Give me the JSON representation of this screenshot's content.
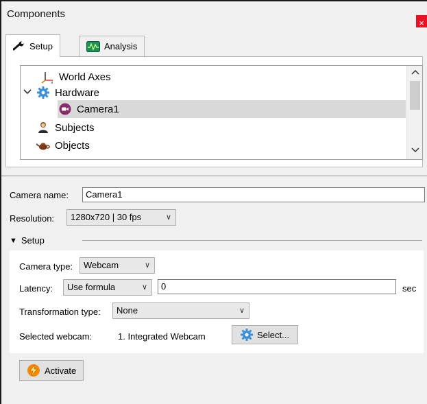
{
  "window": {
    "title": "Components",
    "close_glyph": "×"
  },
  "tabs": [
    {
      "label": "Setup",
      "icon": "wrench-icon",
      "active": true
    },
    {
      "label": "Analysis",
      "icon": "waveform-icon",
      "active": false
    }
  ],
  "tree": {
    "items": [
      {
        "label": "World Axes",
        "icon": "axes-icon",
        "selected": false
      },
      {
        "label": "Hardware",
        "icon": "gear-icon",
        "expanded": true,
        "selected": false
      },
      {
        "label": "Camera1",
        "icon": "camera-icon",
        "selected": true
      },
      {
        "label": "Subjects",
        "icon": "person-icon",
        "selected": false
      },
      {
        "label": "Objects",
        "icon": "teapot-icon",
        "selected": false
      }
    ]
  },
  "properties": {
    "camera_name_label": "Camera name:",
    "camera_name_value": "Camera1",
    "resolution_label": "Resolution:",
    "resolution_value": "1280x720 | 30 fps",
    "setup_group_label": "Setup",
    "camera_type_label": "Camera type:",
    "camera_type_value": "Webcam",
    "latency_label": "Latency:",
    "latency_mode_value": "Use formula",
    "latency_value": "0",
    "latency_unit": "sec",
    "transformation_label": "Transformation type:",
    "transformation_value": "None",
    "selected_webcam_label": "Selected webcam:",
    "selected_webcam_value": "1. Integrated Webcam",
    "select_button_label": "Select...",
    "activate_button_label": "Activate"
  },
  "colors": {
    "close_red": "#e81123",
    "selection_gray": "#d9d9d9",
    "gear_blue": "#3d8fd8",
    "camera_purple": "#8a2a6a",
    "activate_orange": "#f08a00"
  }
}
